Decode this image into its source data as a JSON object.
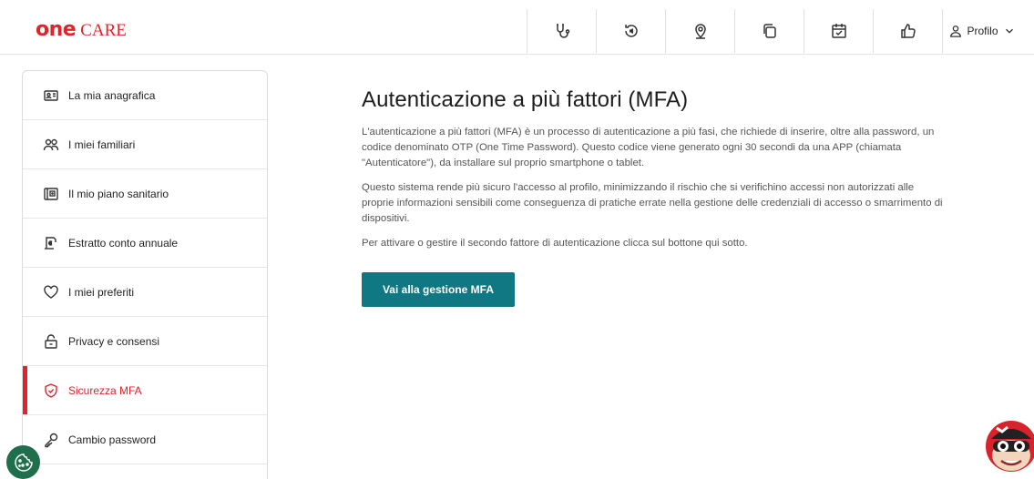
{
  "brand": {
    "one": "one",
    "care": "CARE",
    "color": "#e2222c"
  },
  "header": {
    "icons": [
      "stethoscope-icon",
      "euro-refund-icon",
      "location-pin-icon",
      "documents-icon",
      "calendar-check-icon",
      "thumbs-up-icon"
    ],
    "profile_label": "Profilo"
  },
  "sidebar": {
    "items": [
      {
        "label": "La mia anagrafica",
        "icon": "id-card-icon",
        "active": false
      },
      {
        "label": "I miei familiari",
        "icon": "users-icon",
        "active": false
      },
      {
        "label": "Il mio piano sanitario",
        "icon": "health-plan-icon",
        "active": false
      },
      {
        "label": "Estratto conto annuale",
        "icon": "statement-icon",
        "active": false
      },
      {
        "label": "I miei preferiti",
        "icon": "heart-icon",
        "active": false
      },
      {
        "label": "Privacy e consensi",
        "icon": "lock-icon",
        "active": false
      },
      {
        "label": "Sicurezza MFA",
        "icon": "shield-icon",
        "active": true
      },
      {
        "label": "Cambio password",
        "icon": "key-icon",
        "active": false
      }
    ]
  },
  "main": {
    "title": "Autenticazione a più fattori (MFA)",
    "paragraph1": "L'autenticazione a più fattori (MFA) è un processo di autenticazione a più fasi, che richiede di inserire, oltre alla password, un codice denominato OTP (One Time Password). Questo codice viene generato ogni 30 secondi da una APP (chiamata \"Autenticatore\"), da installare sul proprio smartphone o tablet.",
    "paragraph2": "Questo sistema rende più sicuro l'accesso al profilo, minimizzando il rischio che si verifichino accessi non autorizzati alle proprie informazioni sensibili come conseguenza di pratiche errate nella gestione delle credenziali di accesso o smarrimento di dispositivi.",
    "paragraph3": "Per attivare o gestire il secondo fattore di autenticazione clicca sul bottone qui sotto.",
    "button_label": "Vai alla gestione MFA",
    "button_color": "#0f7882"
  },
  "widgets": {
    "cookie_icon": "cookie-icon",
    "assistant_icon": "mascot-assistant-icon"
  }
}
